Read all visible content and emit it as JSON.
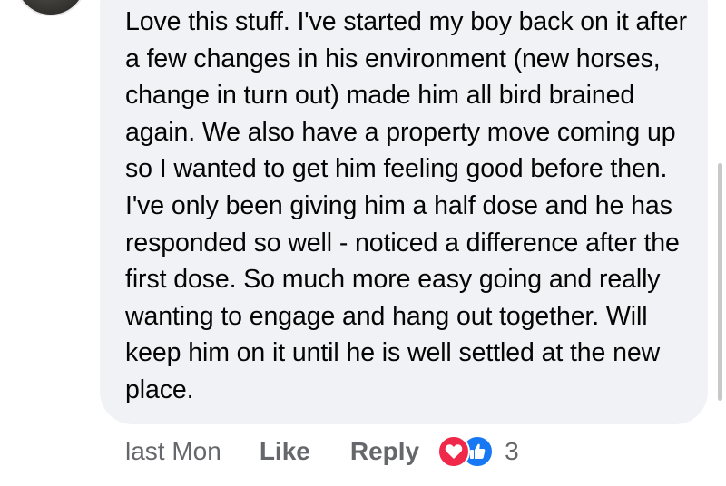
{
  "comment": {
    "text": "Love this stuff. I've started my boy back on it after a few changes in his environment (new horses, change in turn out) made him all bird brained again. We also have a property move coming up so I wanted to get him feeling good before then. I've only been giving him a half dose and he has responded so well - noticed a difference after the first dose. So much more easy going and really wanting to engage and hang out together. Will keep him on it until he is well settled at the new place."
  },
  "actions": {
    "timestamp": "last Mon",
    "like_label": "Like",
    "reply_label": "Reply",
    "reaction_count": "3"
  },
  "reactions": [
    {
      "type": "love",
      "icon": "heart-icon",
      "color": "#f02849"
    },
    {
      "type": "like",
      "icon": "thumbs-up-icon",
      "color": "#1877f2"
    }
  ],
  "colors": {
    "bubble": "#f0f2f5",
    "text": "#050505",
    "secondary": "#65676b"
  }
}
